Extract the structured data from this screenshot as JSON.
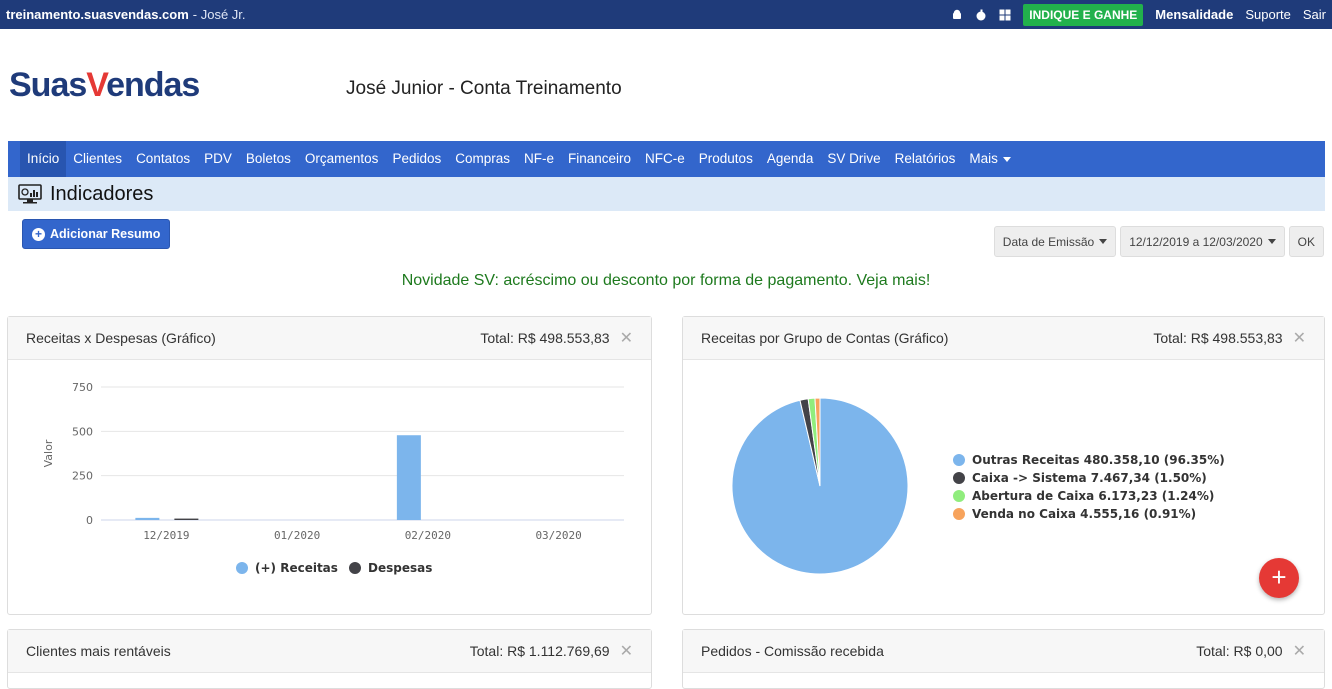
{
  "topbar": {
    "site": "treinamento.suasvendas.com",
    "user": "- José Jr.",
    "indique": "INDIQUE E GANHE",
    "mensalidade": "Mensalidade",
    "suporte": "Suporte",
    "sair": "Sair"
  },
  "logo": {
    "part1": "Suas",
    "part2": "V",
    "part3": "endas"
  },
  "account_title": "José Junior - Conta Treinamento",
  "nav": {
    "items": [
      "Início",
      "Clientes",
      "Contatos",
      "PDV",
      "Boletos",
      "Orçamentos",
      "Pedidos",
      "Compras",
      "NF-e",
      "Financeiro",
      "NFC-e",
      "Produtos",
      "Agenda",
      "SV Drive",
      "Relatórios"
    ],
    "more": "Mais"
  },
  "page_title": "Indicadores",
  "add_button": "Adicionar Resumo",
  "filters": {
    "date_type": "Data de Emissão",
    "date_range": "12/12/2019 a 12/03/2020",
    "ok": "OK"
  },
  "news": "Novidade SV: acréscimo ou desconto por forma de pagamento. Veja mais!",
  "panels": {
    "receitas_despesas": {
      "title": "Receitas x Despesas (Gráfico)",
      "total": "Total: R$ 498.553,83"
    },
    "grupo_contas": {
      "title": "Receitas por Grupo de Contas (Gráfico)",
      "total": "Total: R$ 498.553,83"
    },
    "clientes": {
      "title": "Clientes mais rentáveis",
      "total": "Total: R$ 1.112.769,69"
    },
    "pedidos": {
      "title": "Pedidos - Comissão recebida",
      "total": "Total: R$ 0,00"
    }
  },
  "chart_data": [
    {
      "type": "bar",
      "ylabel": "Valor",
      "categories": [
        "12/2019",
        "01/2020",
        "02/2020",
        "03/2020"
      ],
      "ylim": [
        0,
        750
      ],
      "yticks": [
        0,
        250,
        500,
        750
      ],
      "series": [
        {
          "name": "(+) Receitas",
          "color": "#7cb5ec",
          "values": [
            12,
            0,
            478,
            0
          ]
        },
        {
          "name": "Despesas",
          "color": "#434348",
          "values": [
            8,
            0,
            0,
            0
          ]
        }
      ],
      "legend": "bottom"
    },
    {
      "type": "pie",
      "legend": "right",
      "slices": [
        {
          "label": "Outras Receitas 480.358,10 (96.35%)",
          "value": 96.35,
          "color": "#7cb5ec"
        },
        {
          "label": "Caixa -> Sistema 7.467,34 (1.50%)",
          "value": 1.5,
          "color": "#434348"
        },
        {
          "label": "Abertura de Caixa 6.173,23 (1.24%)",
          "value": 1.24,
          "color": "#90ed7d"
        },
        {
          "label": "Venda no Caixa 4.555,16 (0.91%)",
          "value": 0.91,
          "color": "#f7a35c"
        }
      ]
    }
  ]
}
